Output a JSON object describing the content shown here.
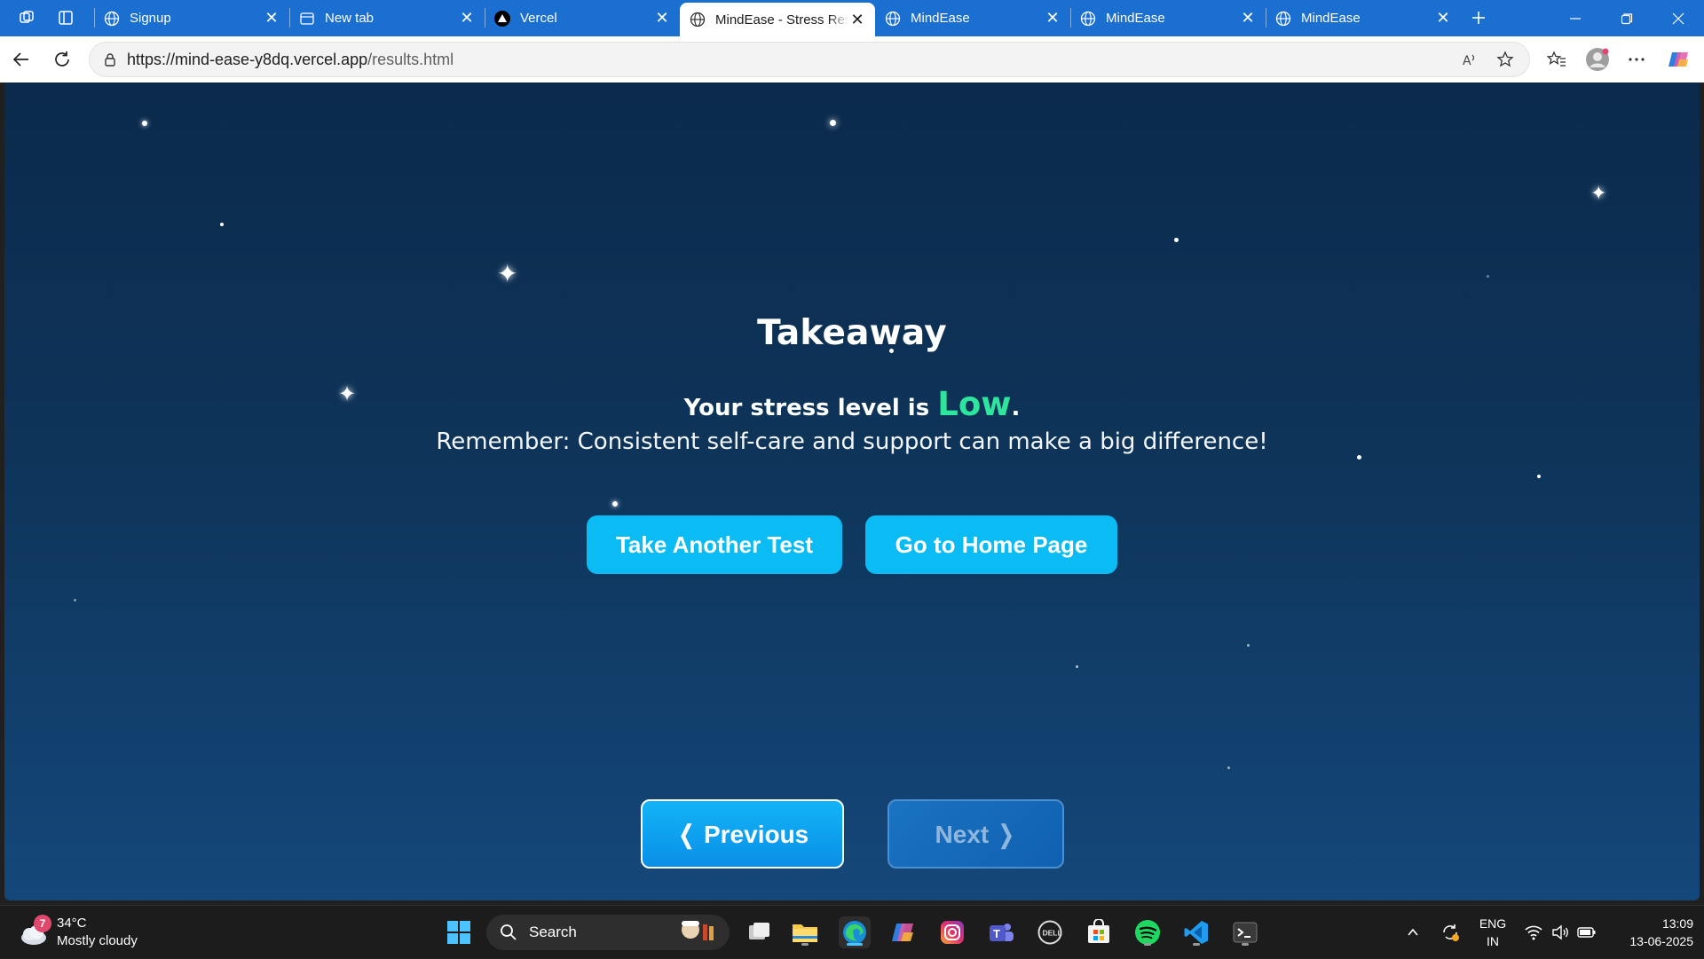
{
  "browser": {
    "tabs": [
      {
        "title": "Signup",
        "favicon": "globe-icon",
        "active": false
      },
      {
        "title": "New tab",
        "favicon": "newtab-icon",
        "active": false
      },
      {
        "title": "Vercel",
        "favicon": "vercel-icon",
        "active": false
      },
      {
        "title": "MindEase - Stress Res",
        "favicon": "globe-icon",
        "active": true
      },
      {
        "title": "MindEase",
        "favicon": "globe-icon",
        "active": false
      },
      {
        "title": "MindEase",
        "favicon": "globe-icon",
        "active": false
      },
      {
        "title": "MindEase",
        "favicon": "globe-icon",
        "active": false
      }
    ],
    "address": {
      "url_host": "https://mind-ease-y8dq.vercel.app",
      "url_path": "/results.html"
    }
  },
  "page": {
    "title": "Takeaway",
    "stress_prefix": "Your stress level is ",
    "stress_level": "Low",
    "stress_suffix": ".",
    "reminder": "Remember: Consistent self-care and support can make a big difference!",
    "buttons": {
      "take_another": "Take Another Test",
      "home": "Go to Home Page",
      "previous": "❬ Previous",
      "next": "Next ❭"
    },
    "colors": {
      "accent_button": "#0bbbf3",
      "stress_low": "#2ee59d",
      "background_top": "#0b2a4c",
      "background_bottom": "#14477a"
    }
  },
  "taskbar": {
    "weather": {
      "badge": "7",
      "temp": "34°C",
      "condition": "Mostly cloudy"
    },
    "search_label": "Search",
    "lang_top": "ENG",
    "lang_bottom": "IN",
    "time": "13:09",
    "date": "13-06-2025"
  }
}
